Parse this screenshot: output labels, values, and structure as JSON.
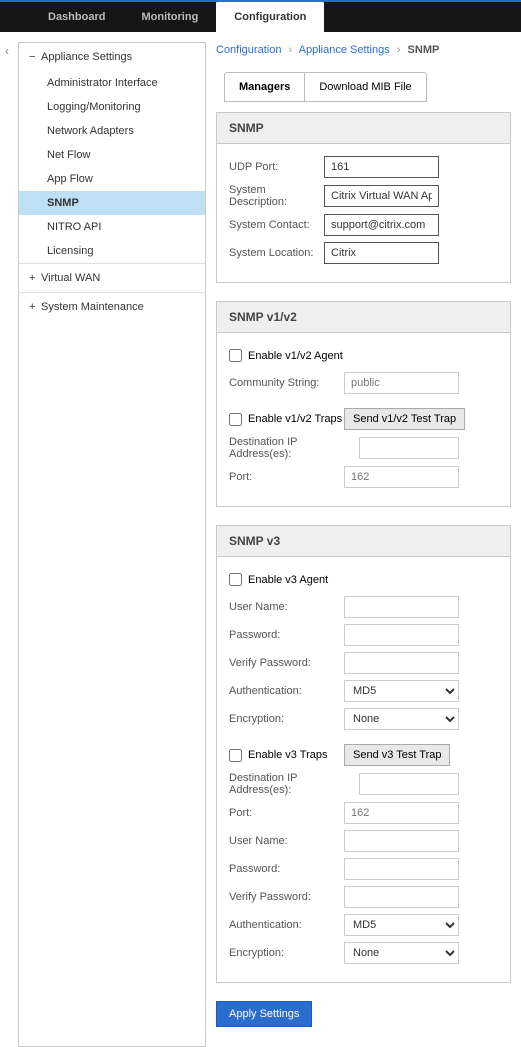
{
  "topnav": {
    "items": [
      {
        "label": "Dashboard"
      },
      {
        "label": "Monitoring"
      },
      {
        "label": "Configuration"
      }
    ],
    "active": 2
  },
  "sidebar": {
    "groups": [
      {
        "label": "Appliance Settings",
        "expanded": true,
        "items": [
          {
            "label": "Administrator Interface"
          },
          {
            "label": "Logging/Monitoring"
          },
          {
            "label": "Network Adapters"
          },
          {
            "label": "Net Flow"
          },
          {
            "label": "App Flow"
          },
          {
            "label": "SNMP",
            "active": true
          },
          {
            "label": "NITRO API"
          },
          {
            "label": "Licensing"
          }
        ]
      },
      {
        "label": "Virtual WAN",
        "expanded": false
      },
      {
        "label": "System Maintenance",
        "expanded": false
      }
    ]
  },
  "breadcrumb": {
    "parts": [
      "Configuration",
      "Appliance Settings",
      "SNMP"
    ]
  },
  "subtabs": {
    "items": [
      "Managers",
      "Download MIB File"
    ],
    "active": 0
  },
  "snmp": {
    "title": "SNMP",
    "udp_port_label": "UDP Port:",
    "udp_port": "161",
    "desc_label": "System Description:",
    "desc": "Citrix Virtual WAN Appliance",
    "contact_label": "System Contact:",
    "contact": "support@citrix.com",
    "location_label": "System Location:",
    "location": "Citrix"
  },
  "v1v2": {
    "title": "SNMP v1/v2",
    "enable_agent_label": "Enable v1/v2 Agent",
    "community_label": "Community String:",
    "community_placeholder": "public",
    "enable_traps_label": "Enable v1/v2 Traps",
    "test_trap_btn": "Send v1/v2 Test Trap",
    "dest_label": "Destination IP Address(es):",
    "port_label": "Port:",
    "port_placeholder": "162"
  },
  "v3": {
    "title": "SNMP v3",
    "enable_agent_label": "Enable v3 Agent",
    "user_label": "User Name:",
    "pass_label": "Password:",
    "verify_label": "Verify Password:",
    "auth_label": "Authentication:",
    "auth_value": "MD5",
    "enc_label": "Encryption:",
    "enc_value": "None",
    "enable_traps_label": "Enable v3 Traps",
    "test_trap_btn": "Send v3 Test Trap",
    "dest_label": "Destination IP Address(es):",
    "port_label": "Port:",
    "port_placeholder": "162"
  },
  "apply_label": "Apply Settings"
}
